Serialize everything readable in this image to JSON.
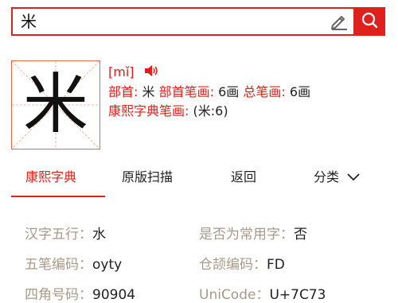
{
  "search": {
    "value": "米"
  },
  "character": {
    "glyph": "米",
    "pinyin": "[mǐ]",
    "radical_label": "部首:",
    "radical": "米",
    "radical_strokes_label": "部首笔画:",
    "radical_strokes": "6画",
    "total_strokes_label": "总笔画:",
    "total_strokes": "6画",
    "kangxi_label": "康熙字典笔画:",
    "kangxi_value": "(米:6)"
  },
  "tabs": [
    "康熙字典",
    "原版扫描",
    "返回",
    "分类"
  ],
  "properties": [
    {
      "key": "汉字五行：",
      "value": "水"
    },
    {
      "key": "是否为常用字：",
      "value": "否"
    },
    {
      "key": "五笔编码：",
      "value": "oyty"
    },
    {
      "key": "仓颉编码：",
      "value": "FD"
    },
    {
      "key": "四角号码：",
      "value": "90904"
    },
    {
      "key": "UniCode：",
      "value": "U+7C73"
    }
  ],
  "colors": {
    "accent": "#e0201c",
    "label": "#aa9988"
  },
  "icons": [
    "pencil-icon",
    "search-icon",
    "speaker-icon",
    "chevron-down-icon"
  ]
}
